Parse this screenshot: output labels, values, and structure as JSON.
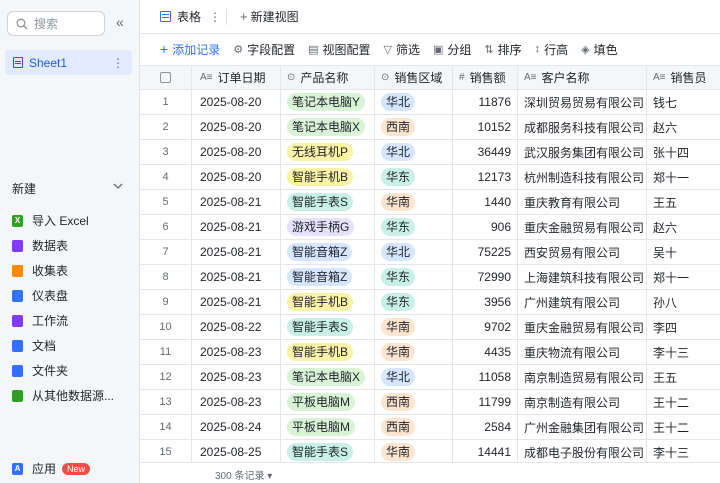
{
  "sidebar": {
    "search_placeholder": "搜索",
    "collapse_glyph": "«",
    "sheet_name": "Sheet1",
    "new_label": "新建",
    "new_items": [
      {
        "label": "导入 Excel",
        "icon": "excel-icon",
        "color": "#2ea121",
        "glyph": "X"
      },
      {
        "label": "数据表",
        "icon": "datatable-icon",
        "color": "#7f3bf5",
        "glyph": ""
      },
      {
        "label": "收集表",
        "icon": "form-icon",
        "color": "#ff8800",
        "glyph": ""
      },
      {
        "label": "仪表盘",
        "icon": "dashboard-icon",
        "color": "#3370ff",
        "glyph": ""
      },
      {
        "label": "工作流",
        "icon": "workflow-icon",
        "color": "#7f3bf5",
        "glyph": ""
      },
      {
        "label": "文档",
        "icon": "doc-icon",
        "color": "#3370ff",
        "glyph": ""
      },
      {
        "label": "文件夹",
        "icon": "folder-icon",
        "color": "#3370ff",
        "glyph": ""
      },
      {
        "label": "从其他数据源...",
        "icon": "datasource-icon",
        "color": "#2ea121",
        "glyph": ""
      }
    ],
    "app_label": "应用",
    "app_badge": "New"
  },
  "tabs": {
    "active": "表格",
    "more": "⋮",
    "new_view": "新建视图"
  },
  "toolbar": [
    {
      "label": "添加记录",
      "glyph": "+",
      "name": "add-record-button"
    },
    {
      "label": "字段配置",
      "glyph": "⚙",
      "name": "field-config-button"
    },
    {
      "label": "视图配置",
      "glyph": "▤",
      "name": "view-config-button"
    },
    {
      "label": "筛选",
      "glyph": "▽",
      "name": "filter-button"
    },
    {
      "label": "分组",
      "glyph": "▣",
      "name": "group-button"
    },
    {
      "label": "排序",
      "glyph": "⇅",
      "name": "sort-button"
    },
    {
      "label": "行高",
      "glyph": "↕",
      "name": "row-height-button"
    },
    {
      "label": "填色",
      "glyph": "◈",
      "name": "fill-color-button"
    }
  ],
  "columns": [
    {
      "label": "订单日期",
      "icon": "A≡"
    },
    {
      "label": "产品名称",
      "icon": "⊙"
    },
    {
      "label": "销售区域",
      "icon": "⊙"
    },
    {
      "label": "销售额",
      "icon": "#"
    },
    {
      "label": "客户名称",
      "icon": "A≡"
    },
    {
      "label": "销售员",
      "icon": "A≡"
    }
  ],
  "product_colors": {
    "笔记本电脑Y": "#d9f3d7",
    "笔记本电脑X": "#d9f3d7",
    "无线耳机P": "#fcf2a8",
    "智能手机B": "#fcf2a8",
    "智能手表S": "#c8f0e6",
    "游戏手柄G": "#e6e2fb",
    "智能音箱Z": "#d6e6ff",
    "平板电脑M": "#d9f3d7"
  },
  "region_colors": {
    "华北": "#d6e6ff",
    "西南": "#fde5cf",
    "华东": "#c8f0e6",
    "华南": "#fde5cf"
  },
  "rows": [
    [
      "1",
      "2025-08-20",
      "笔记本电脑Y",
      "华北",
      "11876",
      "深圳贸易贸易有限公司",
      "钱七"
    ],
    [
      "2",
      "2025-08-20",
      "笔记本电脑X",
      "西南",
      "10152",
      "成都服务科技有限公司",
      "赵六"
    ],
    [
      "3",
      "2025-08-20",
      "无线耳机P",
      "华北",
      "36449",
      "武汉服务集团有限公司",
      "张十四"
    ],
    [
      "4",
      "2025-08-20",
      "智能手机B",
      "华东",
      "12173",
      "杭州制造科技有限公司",
      "郑十一"
    ],
    [
      "5",
      "2025-08-21",
      "智能手表S",
      "华南",
      "1440",
      "重庆教育有限公司",
      "王五"
    ],
    [
      "6",
      "2025-08-21",
      "游戏手柄G",
      "华东",
      "906",
      "重庆金融贸易有限公司",
      "赵六"
    ],
    [
      "7",
      "2025-08-21",
      "智能音箱Z",
      "华北",
      "75225",
      "西安贸易有限公司",
      "吴十"
    ],
    [
      "8",
      "2025-08-21",
      "智能音箱Z",
      "华东",
      "72990",
      "上海建筑科技有限公司",
      "郑十一"
    ],
    [
      "9",
      "2025-08-21",
      "智能手机B",
      "华东",
      "3956",
      "广州建筑有限公司",
      "孙八"
    ],
    [
      "10",
      "2025-08-22",
      "智能手表S",
      "华南",
      "9702",
      "重庆金融贸易有限公司",
      "李四"
    ],
    [
      "11",
      "2025-08-23",
      "智能手机B",
      "华南",
      "4435",
      "重庆物流有限公司",
      "李十三"
    ],
    [
      "12",
      "2025-08-23",
      "笔记本电脑X",
      "华北",
      "11058",
      "南京制造贸易有限公司",
      "王五"
    ],
    [
      "13",
      "2025-08-23",
      "平板电脑M",
      "西南",
      "11799",
      "南京制造有限公司",
      "王十二"
    ],
    [
      "14",
      "2025-08-24",
      "平板电脑M",
      "西南",
      "2584",
      "广州金融集团有限公司",
      "王十二"
    ],
    [
      "15",
      "2025-08-25",
      "智能手表S",
      "华南",
      "14441",
      "成都电子股份有限公司",
      "李十三"
    ]
  ],
  "footer": {
    "record_count": "300 条记录 ▾"
  }
}
